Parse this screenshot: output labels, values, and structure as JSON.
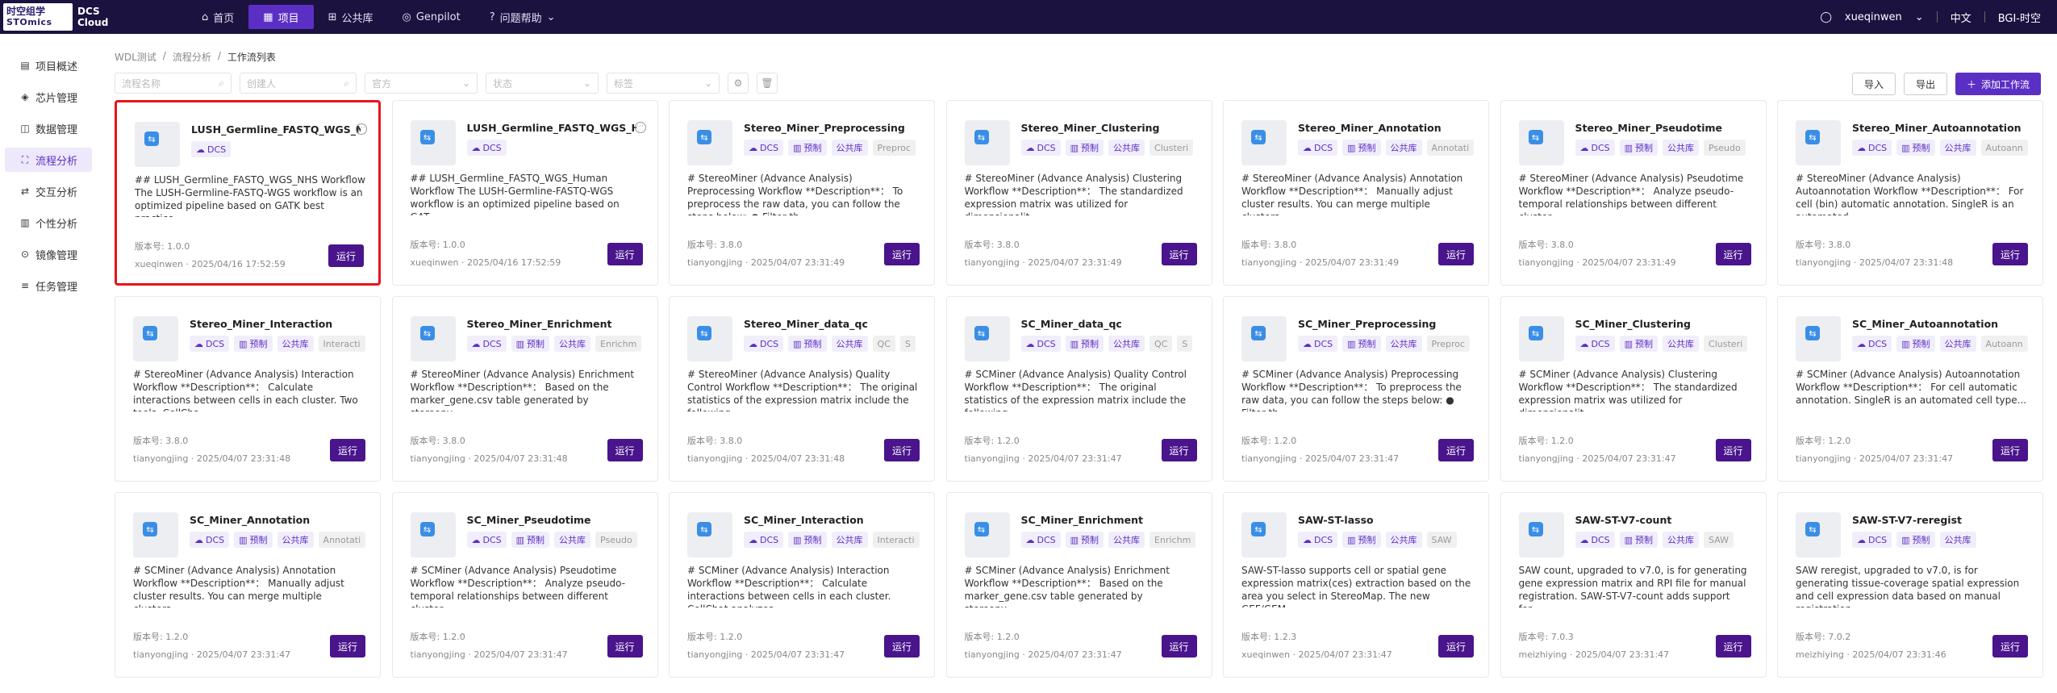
{
  "header": {
    "logo_line1": "时空组学",
    "logo_line2": "STOmics",
    "logo_dcs1": "DCS",
    "logo_dcs2": "Cloud",
    "nav": [
      {
        "label": "首页",
        "icon": "⌂",
        "active": false
      },
      {
        "label": "项目",
        "icon": "▦",
        "active": true
      },
      {
        "label": "公共库",
        "icon": "⊞",
        "active": false
      },
      {
        "label": "Genpilot",
        "icon": "◎",
        "active": false
      },
      {
        "label": "问题帮助",
        "icon": "?",
        "active": false
      }
    ],
    "user": "xueqinwen",
    "lang": "中文",
    "org": "BGI-时空"
  },
  "sidebar": {
    "items": [
      {
        "label": "项目概述",
        "icon": "▤"
      },
      {
        "label": "芯片管理",
        "icon": "◈"
      },
      {
        "label": "数据管理",
        "icon": "◫"
      },
      {
        "label": "流程分析",
        "icon": "⛶"
      },
      {
        "label": "交互分析",
        "icon": "⇄"
      },
      {
        "label": "个性分析",
        "icon": "▥"
      },
      {
        "label": "镜像管理",
        "icon": "⊙"
      },
      {
        "label": "任务管理",
        "icon": "≡"
      }
    ],
    "active_index": 3
  },
  "breadcrumb": [
    "WDL测试",
    "/",
    "流程分析",
    "/",
    "工作流列表"
  ],
  "filters": {
    "name_placeholder": "流程名称",
    "creator_placeholder": "创建人",
    "official_placeholder": "官方",
    "status_placeholder": "状态",
    "tag_placeholder": "标签"
  },
  "actions": {
    "import": "导入",
    "export": "导出",
    "add": "添加工作流"
  },
  "labels": {
    "version_prefix": "版本号:",
    "run": "运行"
  },
  "cards": [
    {
      "title": "LUSH_Germline_FASTQ_WGS_NHS",
      "tags": [
        "DCS"
      ],
      "desc": "## LUSH_Germline_FASTQ_WGS_NHS Workflow The LUSH-Germline-FASTQ-WGS workflow is an optimized pipeline based on GATK best practice...",
      "version": "1.0.0",
      "meta": "xueqinwen · 2025/04/16 17:52:59",
      "highlight": true,
      "more": true
    },
    {
      "title": "LUSH_Germline_FASTQ_WGS_Human",
      "tags": [
        "DCS"
      ],
      "desc": "## LUSH_Germline_FASTQ_WGS_Human Workflow The LUSH-Germline-FASTQ-WGS workflow is an optimized pipeline based on GAT...",
      "version": "1.0.0",
      "meta": "xueqinwen · 2025/04/16 17:52:59",
      "more": true
    },
    {
      "title": "Stereo_Miner_Preprocessing",
      "tags": [
        "DCS",
        "预制",
        "公共库",
        "Preproc"
      ],
      "desc": "# StereoMiner (Advance Analysis) Preprocessing Workflow **Description**： To preprocess the raw data, you can follow the steps below: ● Filter th...",
      "version": "3.8.0",
      "meta": "tianyongjing · 2025/04/07 23:31:49"
    },
    {
      "title": "Stereo_Miner_Clustering",
      "tags": [
        "DCS",
        "预制",
        "公共库",
        "Clusteri"
      ],
      "desc": "# StereoMiner (Advance Analysis) Clustering Workflow **Description**： The standardized expression matrix was utilized for dimensionalit...",
      "version": "3.8.0",
      "meta": "tianyongjing · 2025/04/07 23:31:49"
    },
    {
      "title": "Stereo_Miner_Annotation",
      "tags": [
        "DCS",
        "预制",
        "公共库",
        "Annotati"
      ],
      "desc": "# StereoMiner (Advance Analysis) Annotation Workflow **Description**： Manually adjust cluster results. You can merge multiple clusters,...",
      "version": "3.8.0",
      "meta": "tianyongjing · 2025/04/07 23:31:49"
    },
    {
      "title": "Stereo_Miner_Pseudotime",
      "tags": [
        "DCS",
        "预制",
        "公共库",
        "Pseudo"
      ],
      "desc": "# StereoMiner (Advance Analysis) Pseudotime Workflow **Description**： Analyze pseudo-temporal relationships between different cluster...",
      "version": "3.8.0",
      "meta": "tianyongjing · 2025/04/07 23:31:49"
    },
    {
      "title": "Stereo_Miner_Autoannotation",
      "tags": [
        "DCS",
        "预制",
        "公共库",
        "Autoann"
      ],
      "desc": "# StereoMiner (Advance Analysis) Autoannotation Workflow **Description**： For cell (bin) automatic annotation. SingleR is an automated...",
      "version": "3.8.0",
      "meta": "tianyongjing · 2025/04/07 23:31:48"
    },
    {
      "title": "Stereo_Miner_Interaction",
      "tags": [
        "DCS",
        "预制",
        "公共库",
        "Interacti"
      ],
      "desc": "# StereoMiner (Advance Analysis) Interaction Workflow **Description**： Calculate interactions between cells in each cluster. Two tools, CellCha...",
      "version": "3.8.0",
      "meta": "tianyongjing · 2025/04/07 23:31:48"
    },
    {
      "title": "Stereo_Miner_Enrichment",
      "tags": [
        "DCS",
        "预制",
        "公共库",
        "Enrichm"
      ],
      "desc": "# StereoMiner (Advance Analysis) Enrichment Workflow **Description**： Based on the marker_gene.csv table generated by stereopy,...",
      "version": "3.8.0",
      "meta": "tianyongjing · 2025/04/07 23:31:48"
    },
    {
      "title": "Stereo_Miner_data_qc",
      "tags": [
        "DCS",
        "预制",
        "公共库",
        "QC",
        "S"
      ],
      "desc": "# StereoMiner (Advance Analysis) Quality Control Workflow **Description**： The original statistics of the expression matrix include the following...",
      "version": "3.8.0",
      "meta": "tianyongjing · 2025/04/07 23:31:48"
    },
    {
      "title": "SC_Miner_data_qc",
      "tags": [
        "DCS",
        "预制",
        "公共库",
        "QC",
        "S"
      ],
      "desc": "# SCMiner (Advance Analysis) Quality Control Workflow **Description**： The original statistics of the expression matrix include the following...",
      "version": "1.2.0",
      "meta": "tianyongjing · 2025/04/07 23:31:47"
    },
    {
      "title": "SC_Miner_Preprocessing",
      "tags": [
        "DCS",
        "预制",
        "公共库",
        "Preproc"
      ],
      "desc": "# SCMiner (Advance Analysis) Preprocessing Workflow **Description**： To preprocess the raw data, you can follow the steps below: ● Filter th...",
      "version": "1.2.0",
      "meta": "tianyongjing · 2025/04/07 23:31:47"
    },
    {
      "title": "SC_Miner_Clustering",
      "tags": [
        "DCS",
        "预制",
        "公共库",
        "Clusteri"
      ],
      "desc": "# SCMiner (Advance Analysis) Clustering Workflow **Description**： The standardized expression matrix was utilized for dimensionalit...",
      "version": "1.2.0",
      "meta": "tianyongjing · 2025/04/07 23:31:47"
    },
    {
      "title": "SC_Miner_Autoannotation",
      "tags": [
        "DCS",
        "预制",
        "公共库",
        "Autoann"
      ],
      "desc": "# SCMiner (Advance Analysis) Autoannotation Workflow **Description**： For cell automatic annotation. SingleR is an automated cell type...",
      "version": "1.2.0",
      "meta": "tianyongjing · 2025/04/07 23:31:47"
    },
    {
      "title": "SC_Miner_Annotation",
      "tags": [
        "DCS",
        "预制",
        "公共库",
        "Annotati"
      ],
      "desc": "# SCMiner (Advance Analysis) Annotation Workflow **Description**： Manually adjust cluster results. You can merge multiple clusters,...",
      "version": "1.2.0",
      "meta": "tianyongjing · 2025/04/07 23:31:47"
    },
    {
      "title": "SC_Miner_Pseudotime",
      "tags": [
        "DCS",
        "预制",
        "公共库",
        "Pseudo"
      ],
      "desc": "# SCMiner (Advance Analysis) Pseudotime Workflow **Description**： Analyze pseudo-temporal relationships between different cluster...",
      "version": "1.2.0",
      "meta": "tianyongjing · 2025/04/07 23:31:47"
    },
    {
      "title": "SC_Miner_Interaction",
      "tags": [
        "DCS",
        "预制",
        "公共库",
        "Interacti"
      ],
      "desc": "# SCMiner (Advance Analysis) Interaction Workflow **Description**： Calculate interactions between cells in each cluster. CellChat analyzes...",
      "version": "1.2.0",
      "meta": "tianyongjing · 2025/04/07 23:31:47"
    },
    {
      "title": "SC_Miner_Enrichment",
      "tags": [
        "DCS",
        "预制",
        "公共库",
        "Enrichm"
      ],
      "desc": "# SCMiner (Advance Analysis) Enrichment Workflow **Description**： Based on the marker_gene.csv table generated by stereopy,...",
      "version": "1.2.0",
      "meta": "tianyongjing · 2025/04/07 23:31:47"
    },
    {
      "title": "SAW-ST-lasso",
      "tags": [
        "DCS",
        "预制",
        "公共库",
        "SAW"
      ],
      "desc": "SAW-ST-lasso supports cell or spatial gene expression matrix(ces) extraction based on the area you select in StereoMap. The new GEF/GEM...",
      "version": "1.2.3",
      "meta": "xueqinwen · 2025/04/07 23:31:47"
    },
    {
      "title": "SAW-ST-V7-count",
      "tags": [
        "DCS",
        "预制",
        "公共库",
        "SAW"
      ],
      "desc": "SAW count, upgraded to v7.0, is for generating gene expression matrix and RPI file for manual registration. SAW-ST-V7-count adds support for...",
      "version": "7.0.3",
      "meta": "meizhiying · 2025/04/07 23:31:47"
    },
    {
      "title": "SAW-ST-V7-reregist",
      "tags": [
        "DCS",
        "预制",
        "公共库"
      ],
      "desc": "SAW reregist, upgraded to v7.0, is for generating tissue-coverage spatial expression and cell expression data based on manual registration...",
      "version": "7.0.2",
      "meta": "meizhiying · 2025/04/07 23:31:46"
    }
  ]
}
